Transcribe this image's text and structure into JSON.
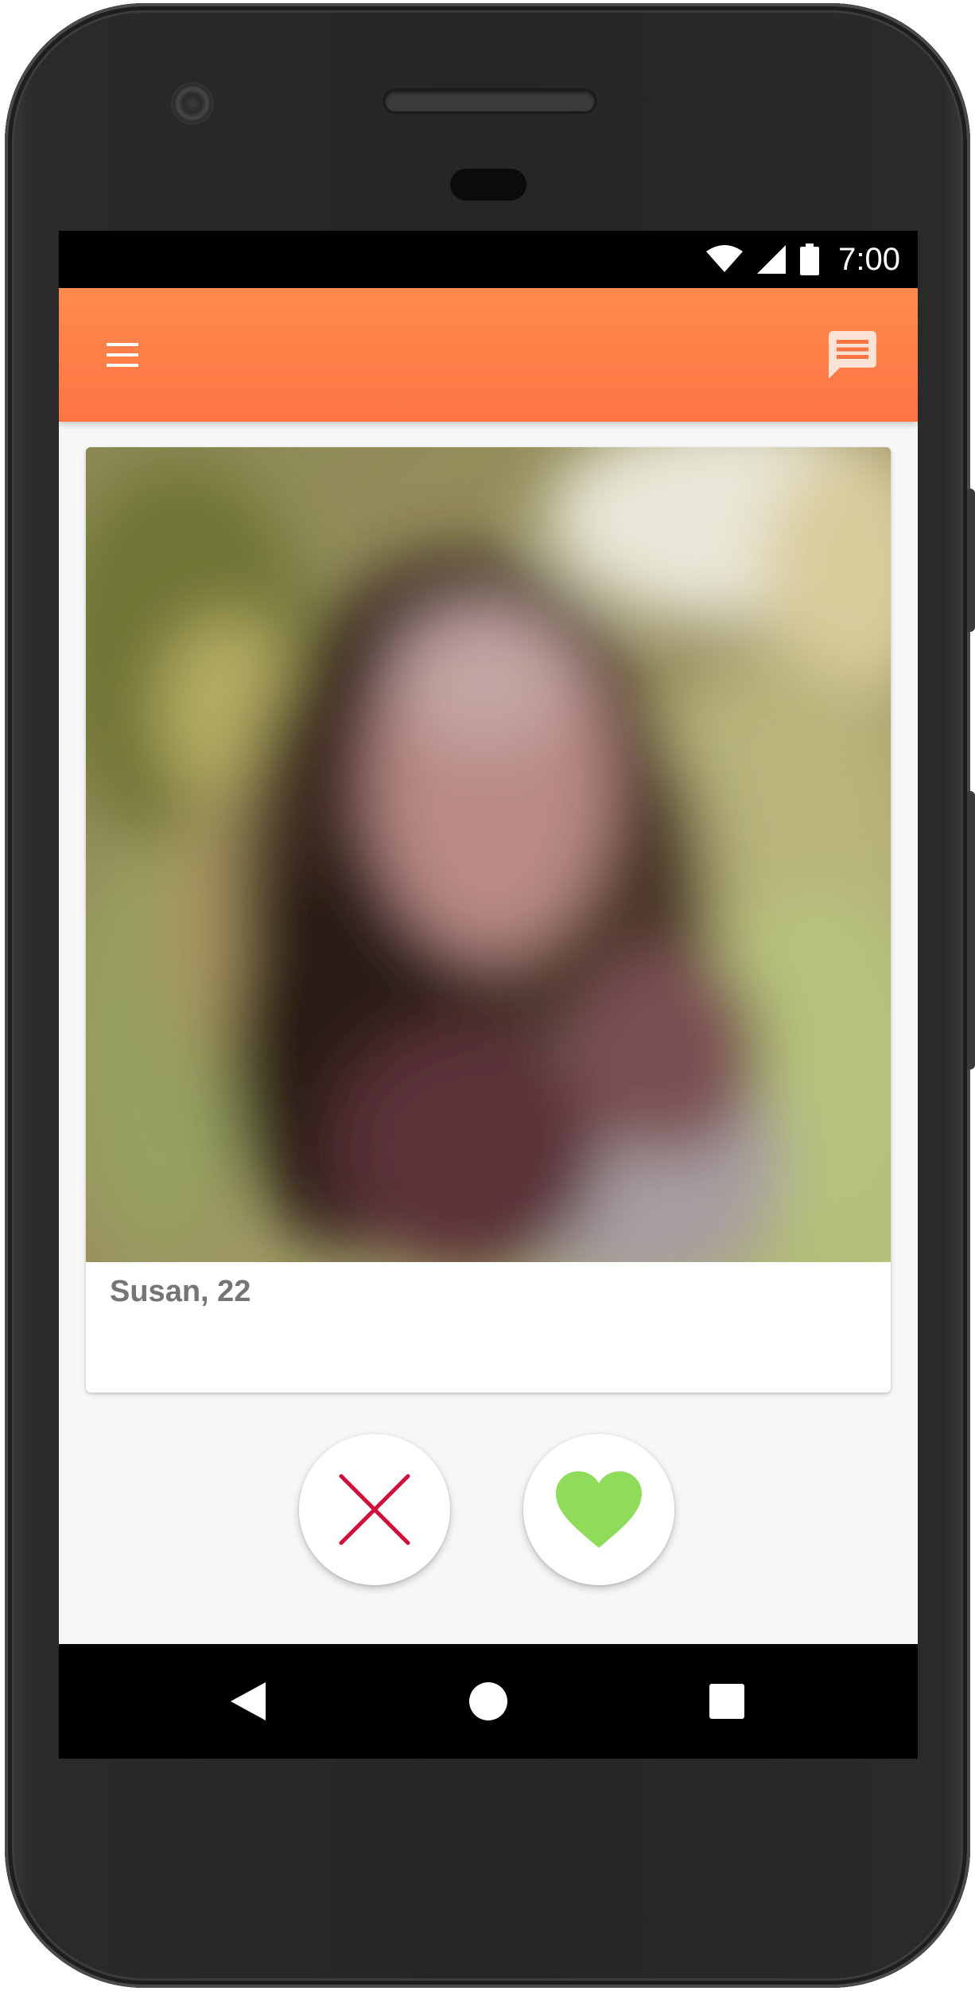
{
  "status_bar": {
    "time": "7:00",
    "icons": [
      "wifi-icon",
      "cellular-signal-icon",
      "battery-icon"
    ]
  },
  "app_bar": {
    "left_icon": "menu-icon",
    "right_icon": "chat-icon",
    "color": "#fd7a47"
  },
  "profile": {
    "name_age": "Susan, 22",
    "photo": "blurred-portrait"
  },
  "actions": {
    "dislike_icon": "close-icon",
    "dislike_color": "#d0103a",
    "like_icon": "heart-icon",
    "like_color": "#8fdb5a"
  },
  "nav": {
    "icons": [
      "back-icon",
      "home-icon",
      "recents-icon"
    ]
  }
}
